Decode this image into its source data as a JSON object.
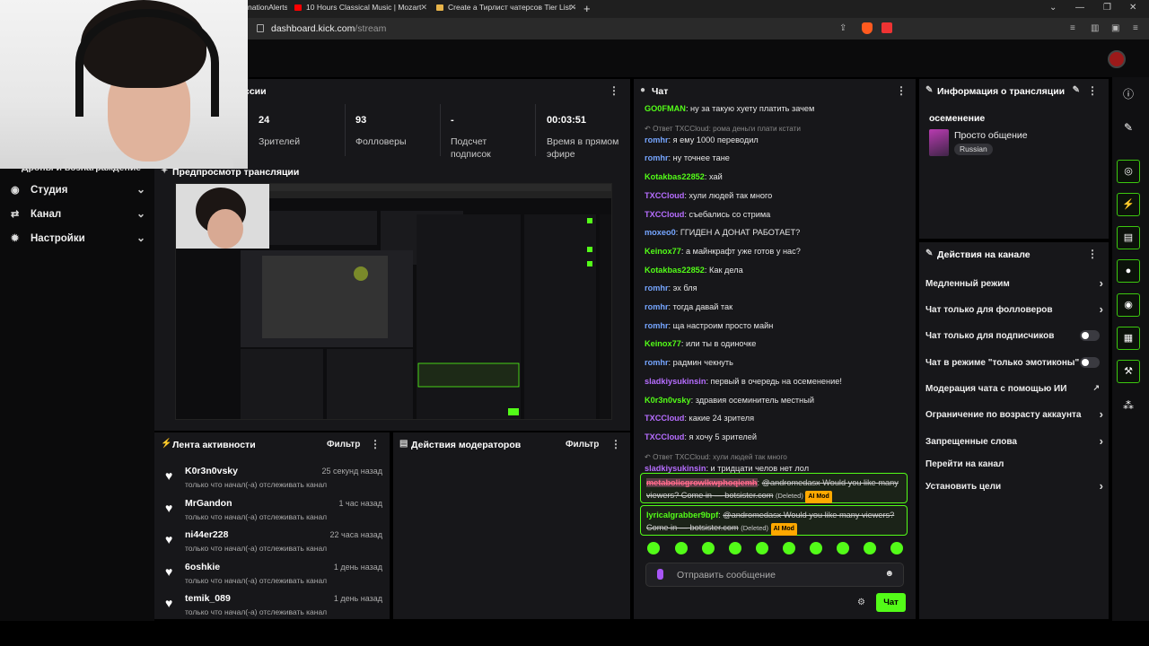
{
  "browser": {
    "tabs": [
      {
        "label": "nationAlerts",
        "icon_color": "#1f1f1f"
      },
      {
        "label": "10 Hours Classical Music | Mozart",
        "icon_color": "#ff0000"
      },
      {
        "label": "Create a Тирлист чатерсов Tier List -",
        "icon_color": "#e8b44a"
      }
    ],
    "url_host": "dashboard.kick.com",
    "url_path": "/stream"
  },
  "nav": {
    "cut_label": "Дропы и вознаграждение",
    "items": [
      {
        "label": "Студия",
        "icon": "camera-icon"
      },
      {
        "label": "Канал",
        "icon": "channel-icon"
      },
      {
        "label": "Настройки",
        "icon": "gear-icon"
      }
    ]
  },
  "session": {
    "title_partial": "ссии",
    "stats": [
      {
        "value": "24",
        "label": "Зрителей"
      },
      {
        "value": "93",
        "label": "Фолловеры"
      },
      {
        "value": "-",
        "label": "Подсчет подписок"
      },
      {
        "value": "00:03:51",
        "label": "Время в прямом эфире"
      }
    ]
  },
  "preview": {
    "title": "Предпросмотр трансляции"
  },
  "activity": {
    "title": "Лента активности",
    "filter": "Фильтр",
    "items": [
      {
        "user": "K0r3n0vsky",
        "time": "25 секунд назад",
        "text": "только что начал(-а) отслеживать канал"
      },
      {
        "user": "MrGandon",
        "time": "1 час назад",
        "text": "только что начал(-а) отслеживать канал"
      },
      {
        "user": "ni44er228",
        "time": "22 часа назад",
        "text": "только что начал(-а) отслеживать канал"
      },
      {
        "user": "6oshkie",
        "time": "1 день назад",
        "text": "только что начал(-а) отслеживать канал"
      },
      {
        "user": "temik_089",
        "time": "1 день назад",
        "text": "только что начал(-а) отслеживать канал"
      }
    ]
  },
  "moderators": {
    "title": "Действия модераторов",
    "filter": "Фильтр"
  },
  "chat": {
    "title": "Чат",
    "messages": [
      {
        "user": "GO0FMAN",
        "color": "#53fc18",
        "text": "ну за такую хуету платить зачем"
      },
      {
        "reply": "Ответ TXCCloud: рома деньги плати кстати"
      },
      {
        "user": "romhr",
        "color": "#75a5ff",
        "text": "я ему 1000 переводил"
      },
      {
        "user": "romhr",
        "color": "#75a5ff",
        "text": "ну точнее тане"
      },
      {
        "user": "Kotakbas22852",
        "color": "#53fc18",
        "text": "хай"
      },
      {
        "user": "TXCCloud",
        "color": "#b66dff",
        "text": "хули людей так много"
      },
      {
        "user": "TXCCloud",
        "color": "#b66dff",
        "text": "съебались со стрима"
      },
      {
        "user": "moxeo0",
        "color": "#75a5ff",
        "text": "ГГИДЕН А ДОНАТ РАБОТАЕТ?"
      },
      {
        "user": "Keinox77",
        "color": "#53fc18",
        "text": "а майнкрафт уже готов у нас?"
      },
      {
        "user": "Kotakbas22852",
        "color": "#53fc18",
        "text": "Как дела"
      },
      {
        "user": "romhr",
        "color": "#75a5ff",
        "text": "эх бля"
      },
      {
        "user": "romhr",
        "color": "#75a5ff",
        "text": "тогда давай так"
      },
      {
        "user": "romhr",
        "color": "#75a5ff",
        "text": "ща настроим просто майн"
      },
      {
        "user": "Keinox77",
        "color": "#53fc18",
        "text": "или ты в одиночке"
      },
      {
        "user": "romhr",
        "color": "#75a5ff",
        "text": "радмин чекнуть"
      },
      {
        "user": "sladkiysukinsin",
        "color": "#b66dff",
        "text": "первый в очередь на осеменение!"
      },
      {
        "user": "K0r3n0vsky",
        "color": "#53fc18",
        "text": "здравия осеминитель местный"
      },
      {
        "user": "TXCCloud",
        "color": "#b66dff",
        "text": "какие 24 зрителя"
      },
      {
        "user": "TXCCloud",
        "color": "#b66dff",
        "text": "я хочу 5 зрителей"
      },
      {
        "reply": "Ответ TXCCloud: хули людей так много"
      },
      {
        "user": "sladkiysukinsin",
        "color": "#b66dff",
        "text": "и тридцати челов нет лол"
      }
    ],
    "flagged": [
      {
        "user": "metabolicgrowlkwphoqiemh",
        "user_color": "#ff6b8b",
        "text": "@andromedasx Would you like many viewers? Come in — botsister.com",
        "deleted": "(Deleted)",
        "badge": "AI Mod"
      },
      {
        "user": "lyricalgrabber9bpf",
        "user_color": "#53fc18",
        "text": "@andromedasx Would you like many viewers? Come in — botsister.com",
        "deleted": "(Deleted)",
        "badge": "AI Mod"
      }
    ],
    "placeholder": "Отправить сообщение",
    "send_label": "Чат"
  },
  "stream_info": {
    "title": "Информация о трансляции",
    "stream_title": "осеменение",
    "category": "Просто общение",
    "language": "Russian"
  },
  "channel_actions": {
    "title": "Действия на канале",
    "items": [
      {
        "label": "Медленный режим",
        "control": "chevron"
      },
      {
        "label": "Чат только для фолловеров",
        "control": "chevron"
      },
      {
        "label": "Чат только для подписчиков",
        "control": "toggle",
        "state": "off"
      },
      {
        "label": "Чат в режиме \"только эмотиконы\"",
        "control": "toggle",
        "state": "off"
      },
      {
        "label": "Модерация чата с помощью ИИ",
        "control": "external"
      },
      {
        "label": "Ограничение по возрасту аккаунта",
        "control": "chevron"
      },
      {
        "label": "Запрещенные слова",
        "control": "chevron"
      },
      {
        "label": "Перейти на канал",
        "control": "none"
      },
      {
        "label": "Установить цели",
        "control": "chevron"
      }
    ]
  },
  "colors": {
    "accent": "#53fc18",
    "panel": "#17171a",
    "background": "#0b0b0c"
  }
}
